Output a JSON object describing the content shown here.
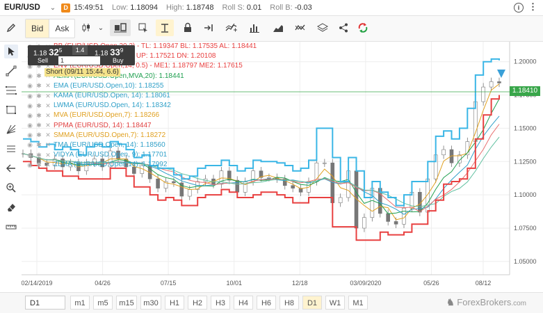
{
  "header": {
    "symbol": "EUR/USD",
    "badge": "D",
    "time": "15:49:51",
    "low_label": "Low:",
    "low_value": "1.18094",
    "high_label": "High:",
    "high_value": "1.18748",
    "rollS_label": "Roll S:",
    "rollS_value": "0.01",
    "rollB_label": "Roll B:",
    "rollB_value": "-0.03",
    "info_icon": "i",
    "more_icon": "⋮"
  },
  "toolbar": {
    "bid_label": "Bid",
    "ask_label": "Ask"
  },
  "trade_panel": {
    "sell_big": "1.18 ",
    "sell_pips": "32",
    "sell_sup": "5",
    "buy_big": "1.18 ",
    "buy_pips": "33",
    "buy_sup": "9",
    "spread": "1.4",
    "sell_label": "Sell",
    "buy_label": "Buy",
    "qty": "1"
  },
  "short_label": "Short (09/11 15:44, 6.6)",
  "legend": [
    {
      "text": "BB (EUR/USD.Open,20,2) - TL: 1.19347 BL: 1.17535 AL: 1.18441",
      "color": "#e84040"
    },
    {
      "text": "DC (EUR/USD.Open,20) - UP: 1.17521 DN: 1.20108",
      "color": "#e84040"
    },
    {
      "text": "ENV (EUR/USD.Open,14, 0.5) - ME1: 1.18797 ME2: 1.17615",
      "color": "#e84040"
    },
    {
      "text": "ALMA (EUR/USD.Open,MVA,20): 1.18441",
      "color": "#20a050"
    },
    {
      "text": "EMA (EUR/USD.Open,10): 1.18255",
      "color": "#30a0c8"
    },
    {
      "text": "KAMA (EUR/USD.Open, 14): 1.18061",
      "color": "#30a0c8"
    },
    {
      "text": "LWMA (EUR/USD.Open, 14): 1.18342",
      "color": "#30a0c8"
    },
    {
      "text": "MVA (EUR/USD.Open,7): 1.18266",
      "color": "#e0a020"
    },
    {
      "text": "PPMA (EUR/USD, 14): 1.18447",
      "color": "#e04040"
    },
    {
      "text": "SMMA (EUR/USD.Open,7): 1.18272",
      "color": "#e0a020"
    },
    {
      "text": "TMA (EUR/USD.Open, 14): 1.18560",
      "color": "#30a0c8"
    },
    {
      "text": "VIDYA (EUR/USD.Open, 9): 1.17701",
      "color": "#30a0c8"
    },
    {
      "text": "ZLMA (EUR/USD.Open,14): 1.17992",
      "color": "#30a0c8"
    }
  ],
  "current_price": "1.18410",
  "chart_data": {
    "type": "line",
    "title": "",
    "symbol": "EUR/USD",
    "timeframe": "D1",
    "x_ticks": [
      "02/14/2019",
      "04/26",
      "07/15",
      "10/01",
      "12/18",
      "03/09/2020",
      "05/26",
      "08/12"
    ],
    "y_ticks": [
      "1.20000",
      "1.17500",
      "1.15000",
      "1.12500",
      "1.10000",
      "1.07500",
      "1.05000"
    ],
    "ylim": [
      1.04,
      1.215
    ],
    "grid": true,
    "series": [
      {
        "name": "EUR/USD",
        "values": [
          1.131,
          1.128,
          1.124,
          1.122,
          1.127,
          1.121,
          1.124,
          1.118,
          1.124,
          1.127,
          1.121,
          1.133,
          1.127,
          1.121,
          1.116,
          1.122,
          1.112,
          1.105,
          1.11,
          1.109,
          1.099,
          1.104,
          1.11,
          1.112,
          1.108,
          1.118,
          1.111,
          1.102,
          1.11,
          1.118,
          1.113,
          1.113,
          1.112,
          1.107,
          1.105,
          1.102,
          1.11,
          1.124,
          1.124,
          1.094,
          1.098,
          1.118,
          1.075,
          1.083,
          1.105,
          1.086,
          1.08,
          1.078,
          1.09,
          1.102,
          1.087,
          1.112,
          1.13,
          1.134,
          1.124,
          1.13,
          1.14,
          1.17,
          1.181,
          1.185,
          1.184
        ]
      },
      {
        "name": "Upper band",
        "values": [
          1.142,
          1.14,
          1.136,
          1.138,
          1.134,
          1.136,
          1.134,
          1.13,
          1.136,
          1.138,
          1.136,
          1.14,
          1.138,
          1.134,
          1.128,
          1.13,
          1.122,
          1.12,
          1.12,
          1.115,
          1.112,
          1.114,
          1.12,
          1.122,
          1.122,
          1.126,
          1.122,
          1.118,
          1.12,
          1.126,
          1.125,
          1.125,
          1.124,
          1.122,
          1.118,
          1.12,
          1.126,
          1.15,
          1.15,
          1.128,
          1.11,
          1.128,
          1.118,
          1.098,
          1.11,
          1.102,
          1.098,
          1.092,
          1.1,
          1.11,
          1.11,
          1.125,
          1.144,
          1.148,
          1.142,
          1.15,
          1.165,
          1.19,
          1.2,
          1.202,
          1.201
        ]
      },
      {
        "name": "Lower band",
        "values": [
          1.125,
          1.122,
          1.12,
          1.118,
          1.118,
          1.114,
          1.114,
          1.112,
          1.112,
          1.112,
          1.112,
          1.12,
          1.12,
          1.114,
          1.106,
          1.106,
          1.1,
          1.096,
          1.098,
          1.096,
          1.092,
          1.092,
          1.098,
          1.1,
          1.1,
          1.104,
          1.102,
          1.098,
          1.098,
          1.1,
          1.102,
          1.102,
          1.1,
          1.098,
          1.094,
          1.094,
          1.098,
          1.098,
          1.098,
          1.076,
          1.076,
          1.076,
          1.066,
          1.066,
          1.066,
          1.072,
          1.07,
          1.07,
          1.072,
          1.078,
          1.078,
          1.088,
          1.096,
          1.108,
          1.11,
          1.112,
          1.12,
          1.142,
          1.16,
          1.172,
          1.175
        ]
      }
    ]
  },
  "timeframes": {
    "selected": "D1",
    "items": [
      "m1",
      "m5",
      "m15",
      "m30",
      "H1",
      "H2",
      "H3",
      "H4",
      "H6",
      "H8",
      "D1",
      "W1",
      "M1"
    ]
  },
  "watermark": "ForexBrokers",
  "watermark_suffix": ".com"
}
